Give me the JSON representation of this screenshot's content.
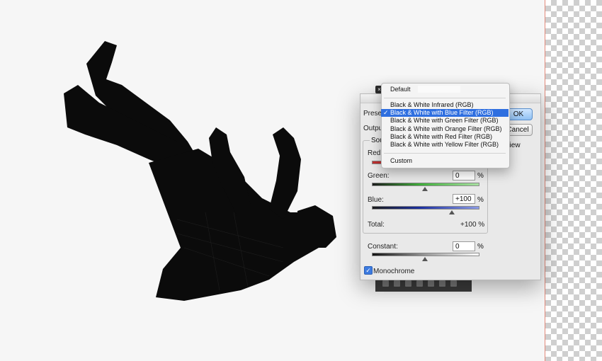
{
  "dialog": {
    "preset_label": "Preset",
    "output_label": "Output",
    "source_label": "Sou",
    "ok_label": "OK",
    "cancel_label": "Cancel",
    "preview_label": "eview",
    "close_glyph": "×",
    "red_label": "Red:",
    "green_label": "Green:",
    "green_value": "0",
    "blue_label": "Blue:",
    "blue_value": "+100",
    "percent": "%",
    "total_label": "Total:",
    "total_value": "+100 %",
    "constant_label": "Constant:",
    "constant_value": "0",
    "monochrome_label": "Monochrome",
    "monochrome_checked": true,
    "green_slider_level": 0.5,
    "blue_slider_level": 0.75,
    "constant_slider_level": 0.5
  },
  "preset_menu": {
    "default_item": "Default",
    "items": [
      "Black & White Infrared (RGB)",
      "Black & White with Blue Filter (RGB)",
      "Black & White with Green Filter (RGB)",
      "Black & White with Orange Filter (RGB)",
      "Black & White with Red Filter (RGB)",
      "Black & White with Yellow Filter (RGB)"
    ],
    "selected_item": "Black & White with Blue Filter (RGB)",
    "custom_item": "Custom",
    "check_glyph": "✓"
  },
  "colors": {
    "accent": "#2f6fe0",
    "green_track": "#3fae3a",
    "blue_track": "#1b2fa0"
  }
}
